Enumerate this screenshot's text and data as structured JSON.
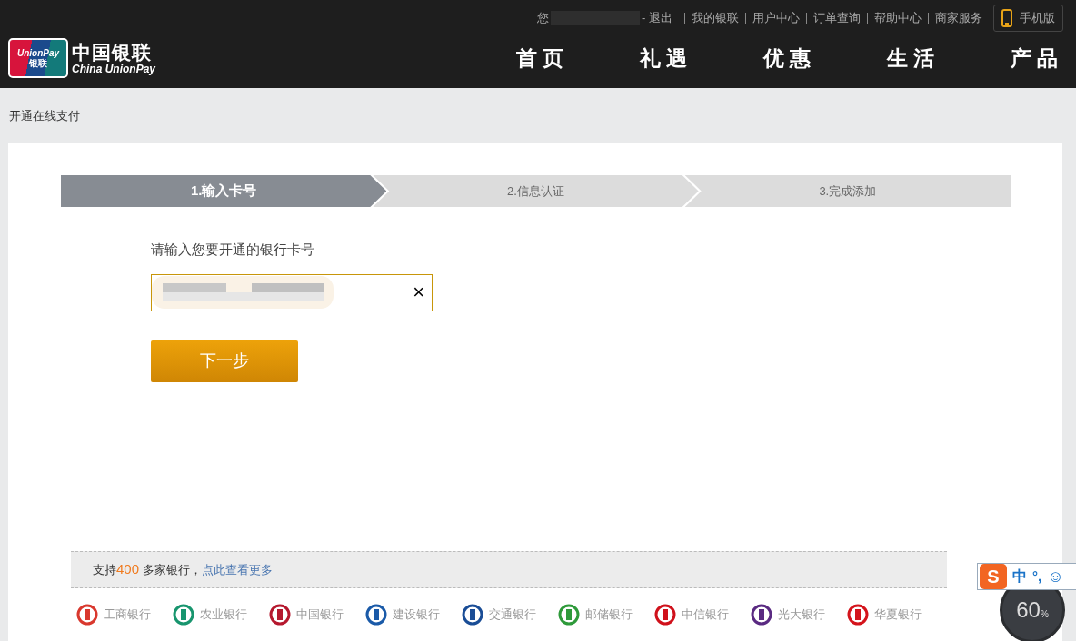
{
  "header": {
    "greeting": "您",
    "logout": "- 退出",
    "links": [
      "我的银联",
      "用户中心",
      "订单查询",
      "帮助中心",
      "商家服务"
    ],
    "mobile_button": "手机版",
    "logo": {
      "card_top": "UnionPay",
      "card_bottom": "银联",
      "name": "中国银联",
      "name_en": "China UnionPay"
    },
    "nav": [
      "首页",
      "礼遇",
      "优惠",
      "生活",
      "产品"
    ]
  },
  "breadcrumb": "开通在线支付",
  "steps": [
    {
      "label": "1.输入卡号",
      "selected": true
    },
    {
      "label": "2.信息认证",
      "selected": false
    },
    {
      "label": "3.完成添加",
      "selected": false
    }
  ],
  "form": {
    "label": "请输入您要开通的银行卡号",
    "clear": "×",
    "next_button": "下一步"
  },
  "banks_notice": {
    "prefix": "支持",
    "count": "400",
    "suffix": " 多家银行，",
    "link": "点此查看更多"
  },
  "banks": [
    {
      "name": "工商银行",
      "color": "#d9382e"
    },
    {
      "name": "农业银行",
      "color": "#18956e"
    },
    {
      "name": "中国银行",
      "color": "#b5182e"
    },
    {
      "name": "建设银行",
      "color": "#1a5aa8"
    },
    {
      "name": "交通银行",
      "color": "#1a4d96"
    },
    {
      "name": "邮储银行",
      "color": "#2e9a3a"
    },
    {
      "name": "中信银行",
      "color": "#d0111b"
    },
    {
      "name": "光大银行",
      "color": "#5a2a82"
    },
    {
      "name": "华夏银行",
      "color": "#d4141c"
    }
  ],
  "ime_bar": {
    "logo": "S",
    "mode": "中",
    "punct": "°,",
    "emoji": "☺"
  },
  "speed_widget": {
    "value": "60",
    "unit": "%"
  }
}
